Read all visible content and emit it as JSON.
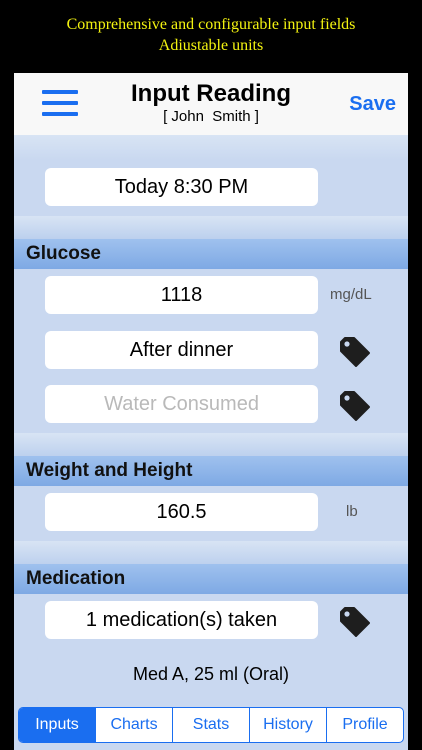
{
  "promo": {
    "line1": "Comprehensive and configurable input fields",
    "line2": "Adiustable units"
  },
  "navbar": {
    "title": "Input Reading",
    "subtitle": "[ John  Smith ]",
    "save_label": "Save",
    "menu_icon": "hamburger-menu-icon"
  },
  "datetime": {
    "value": "Today 8:30 PM"
  },
  "glucose": {
    "header": "Glucose",
    "value": "1118",
    "unit": "mg/dL",
    "timing": "After dinner",
    "water_placeholder": "Water Consumed"
  },
  "weight": {
    "header": "Weight and Height",
    "value": "160.5",
    "unit": "lb"
  },
  "medication": {
    "header": "Medication",
    "taken": "1 medication(s) taken",
    "summary": "Med A, 25 ml (Oral)"
  },
  "tabs": [
    {
      "label": "Inputs",
      "active": true
    },
    {
      "label": "Charts"
    },
    {
      "label": "Stats"
    },
    {
      "label": "History"
    },
    {
      "label": "Profile"
    }
  ],
  "colors": {
    "accent": "#1a6ef0",
    "section_header": "#8fb3e9",
    "background": "#c9d8f0",
    "promo_text": "#f4f410"
  }
}
